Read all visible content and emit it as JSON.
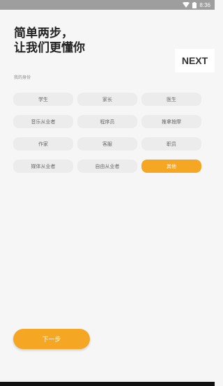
{
  "status_bar": {
    "time": "8:36"
  },
  "header": {
    "title_line1": "简单两步，",
    "title_line2": "让我们更懂你",
    "next_label": "NEXT"
  },
  "identity": {
    "label": "我的身份",
    "options": [
      {
        "label": "学生",
        "selected": false
      },
      {
        "label": "家长",
        "selected": false
      },
      {
        "label": "医生",
        "selected": false
      },
      {
        "label": "音乐从业者",
        "selected": false
      },
      {
        "label": "程序员",
        "selected": false
      },
      {
        "label": "推拿按摩",
        "selected": false
      },
      {
        "label": "作家",
        "selected": false
      },
      {
        "label": "客服",
        "selected": false
      },
      {
        "label": "职员",
        "selected": false
      },
      {
        "label": "媒体从业者",
        "selected": false
      },
      {
        "label": "自由从业者",
        "selected": false
      },
      {
        "label": "其他",
        "selected": true
      }
    ]
  },
  "footer": {
    "next_step_label": "下一步"
  },
  "colors": {
    "accent": "#f5a623",
    "chip": "#ececec",
    "background": "#f6f6f6"
  },
  "icons": [
    "wifi-icon",
    "battery-icon"
  ]
}
